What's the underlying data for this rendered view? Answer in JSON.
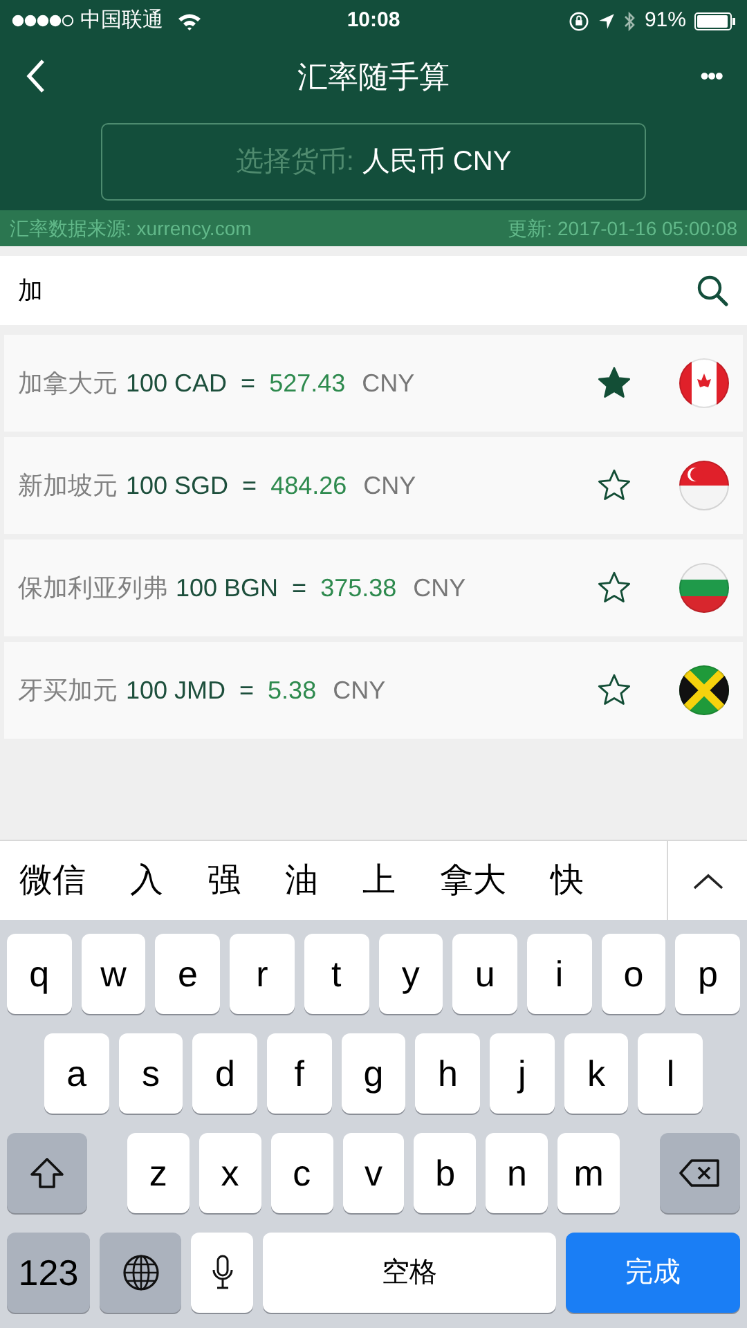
{
  "status_bar": {
    "carrier": "中国联通",
    "time": "10:08",
    "battery": "91%"
  },
  "nav": {
    "title": "汇率随手算",
    "more": "•••"
  },
  "currency_selector": {
    "label": "选择货币:",
    "value": "人民币 CNY"
  },
  "info_bar": {
    "source": "汇率数据来源: xurrency.com",
    "updated": "更新: 2017-01-16 05:00:08"
  },
  "search": {
    "value": "加"
  },
  "rates": [
    {
      "name": "加拿大元",
      "amount": "100 CAD",
      "equals": "=",
      "result": "527.43",
      "unit": "CNY",
      "starred": true,
      "flag": {
        "kind": "ca"
      }
    },
    {
      "name": "新加坡元",
      "amount": "100 SGD",
      "equals": "=",
      "result": "484.26",
      "unit": "CNY",
      "starred": false,
      "flag": {
        "kind": "sg"
      }
    },
    {
      "name": "保加利亚列弗",
      "amount": "100 BGN",
      "equals": "=",
      "result": "375.38",
      "unit": "CNY",
      "starred": false,
      "flag": {
        "kind": "bg"
      }
    },
    {
      "name": "牙买加元",
      "amount": "100 JMD",
      "equals": "=",
      "result": "5.38",
      "unit": "CNY",
      "starred": false,
      "flag": {
        "kind": "jm"
      }
    }
  ],
  "candidates": [
    "微信",
    "入",
    "强",
    "油",
    "上",
    "拿大",
    "快"
  ],
  "keyboard": {
    "rows": [
      [
        "q",
        "w",
        "e",
        "r",
        "t",
        "y",
        "u",
        "i",
        "o",
        "p"
      ],
      [
        "a",
        "s",
        "d",
        "f",
        "g",
        "h",
        "j",
        "k",
        "l"
      ],
      [
        "z",
        "x",
        "c",
        "v",
        "b",
        "n",
        "m"
      ]
    ],
    "numbers": "123",
    "space": "空格",
    "done": "完成"
  }
}
